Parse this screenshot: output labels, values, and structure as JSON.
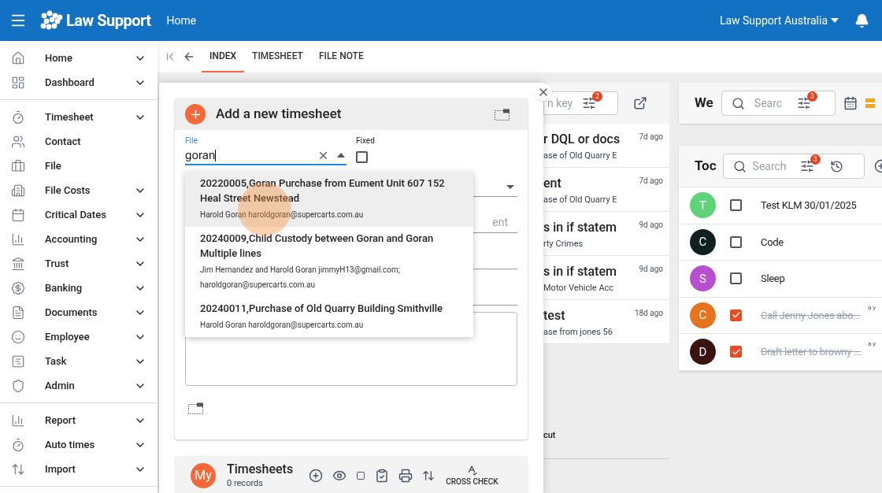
{
  "header": {
    "title": "Law Support",
    "breadcrumb": "Home",
    "organization": "Law Support Australia"
  },
  "sidebar": {
    "groups": [
      [
        {
          "label": "Home",
          "expandable": true
        },
        {
          "label": "Dashboard",
          "expandable": true
        }
      ],
      [
        {
          "label": "Timesheet",
          "expandable": true
        },
        {
          "label": "Contact",
          "expandable": false
        },
        {
          "label": "File",
          "expandable": false
        },
        {
          "label": "File Costs",
          "expandable": true
        },
        {
          "label": "Critical Dates",
          "expandable": true
        },
        {
          "label": "Accounting",
          "expandable": true
        },
        {
          "label": "Trust",
          "expandable": true
        },
        {
          "label": "Banking",
          "expandable": true
        },
        {
          "label": "Documents",
          "expandable": true
        },
        {
          "label": "Employee",
          "expandable": true
        },
        {
          "label": "Task",
          "expandable": true
        },
        {
          "label": "Admin",
          "expandable": true
        }
      ],
      [
        {
          "label": "Report",
          "expandable": true
        },
        {
          "label": "Auto times",
          "expandable": true
        },
        {
          "label": "Import",
          "expandable": true
        }
      ]
    ]
  },
  "tabs": [
    {
      "label": "INDEX",
      "selected": true
    },
    {
      "label": "TIMESHEET",
      "selected": false
    },
    {
      "label": "FILE NOTE",
      "selected": false
    }
  ],
  "dialog": {
    "title": "Add a new timesheet",
    "file_field": {
      "label": "File",
      "value": "goran"
    },
    "fixed": {
      "label": "Fixed",
      "checked": false
    },
    "hidden_placeholder": "ent",
    "suggestions": [
      {
        "title": "20220005,Goran Purchase from Eument Unit 607 152 Heal Street Newstead",
        "detail": "Harold Goran haroldgoran@supercarts.com.au",
        "selected": true
      },
      {
        "title": "20240009,Child Custody between Goran and Goran Multiple lines",
        "detail": "Jim Hernandez and Harold Goran jimmyH13@gmail.com; haroldgoran@supercarts.com.au",
        "selected": false
      },
      {
        "title": "20240011,Purchase of Old Quarry Building Smithville",
        "detail": "Harold Goran haroldgoran@supercarts.com.au",
        "selected": false
      }
    ]
  },
  "timesheets": {
    "avatar": "My",
    "title": "Timesheets",
    "count": "0 records",
    "action": "CROSS CHECK"
  },
  "file_notes": {
    "search_placeholder": "n key",
    "filter_count": "2",
    "footer_text": "cut",
    "items": [
      {
        "title": "r DQL or docs",
        "subtitle": "ase of Old Quarry E",
        "time": "7d ago"
      },
      {
        "title": "ent",
        "subtitle": "ase of Old Quarry E",
        "time": "7d ago"
      },
      {
        "title": "s in if statem",
        "subtitle": "rty Crimes",
        "time": "9d ago"
      },
      {
        "title": "s in if statem",
        "subtitle": "Motor Vehicle Acc",
        "time": "9d ago"
      },
      {
        "title": "test",
        "subtitle": "ase from jones 56",
        "time": "18d ago"
      }
    ]
  },
  "week": {
    "title": "We",
    "search_placeholder": "Searc",
    "filter_count": "3"
  },
  "todo": {
    "title": "Toc",
    "search_placeholder": "Search",
    "filter_count": "3",
    "items": [
      {
        "avatar": "T",
        "color": "#5fd37a",
        "label": "Test KLM 30/01/2025",
        "done": false
      },
      {
        "avatar": "C",
        "color": "#102020",
        "label": "Code",
        "done": false
      },
      {
        "avatar": "S",
        "color": "#b84fd0",
        "label": "Sleep",
        "done": false
      },
      {
        "avatar": "C",
        "color": "#e5741f",
        "label": "Call Jenny Jones abo...",
        "done": true,
        "time": "a y"
      },
      {
        "avatar": "D",
        "color": "#3a1410",
        "label": "Draft letter to browny ...",
        "done": true,
        "time": "a y"
      }
    ]
  }
}
